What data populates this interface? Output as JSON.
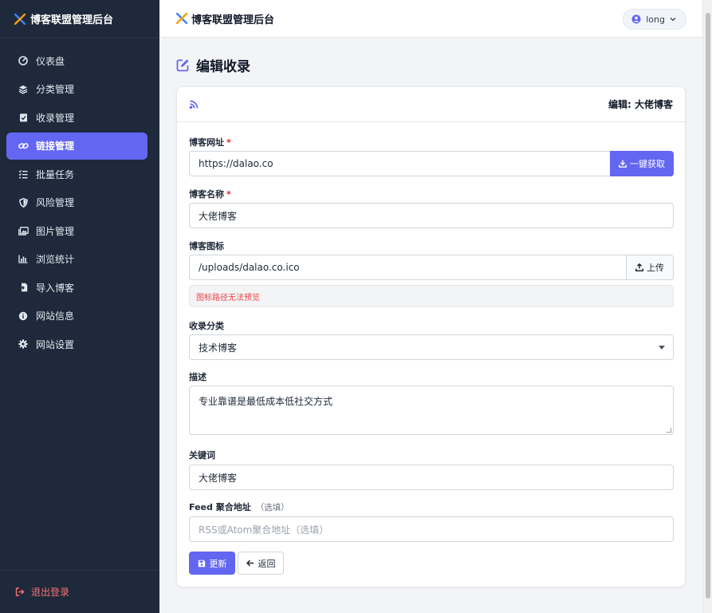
{
  "app": {
    "title": "博客联盟管理后台"
  },
  "sidebar": {
    "items": [
      {
        "label": "仪表盘",
        "icon": "dashboard-icon",
        "active": false
      },
      {
        "label": "分类管理",
        "icon": "layers-icon",
        "active": false
      },
      {
        "label": "收录管理",
        "icon": "clipboard-check-icon",
        "active": false
      },
      {
        "label": "链接管理",
        "icon": "link-icon",
        "active": true
      },
      {
        "label": "批量任务",
        "icon": "task-list-icon",
        "active": false
      },
      {
        "label": "风险管理",
        "icon": "shield-icon",
        "active": false
      },
      {
        "label": "图片管理",
        "icon": "image-icon",
        "active": false
      },
      {
        "label": "浏览统计",
        "icon": "bar-chart-icon",
        "active": false
      },
      {
        "label": "导入博客",
        "icon": "file-import-icon",
        "active": false
      },
      {
        "label": "网站信息",
        "icon": "info-icon",
        "active": false
      },
      {
        "label": "网站设置",
        "icon": "gear-icon",
        "active": false
      }
    ],
    "logout_label": "退出登录"
  },
  "header": {
    "title": "博客联盟管理后台",
    "user": "long"
  },
  "page": {
    "heading": "编辑收录"
  },
  "card": {
    "edit_title": "编辑: 大佬博客"
  },
  "form": {
    "url": {
      "label": "博客网址",
      "required": "*",
      "value": "https://dalao.co",
      "fetch_label": "一键获取"
    },
    "name": {
      "label": "博客名称",
      "required": "*",
      "value": "大佬博客"
    },
    "icon": {
      "label": "博客图标",
      "value": "/uploads/dalao.co.ico",
      "upload_label": "上传",
      "preview_error": "图标路径无法预览"
    },
    "category": {
      "label": "收录分类",
      "value": "技术博客"
    },
    "description": {
      "label": "描述",
      "value": "专业靠谱是最低成本低社交方式"
    },
    "keywords": {
      "label": "关键词",
      "value": "大佬博客"
    },
    "feed": {
      "label": "Feed 聚合地址",
      "optional": "（选填）",
      "placeholder": "RSS或Atom聚合地址（选填）"
    }
  },
  "actions": {
    "update_label": "更新",
    "back_label": "返回"
  },
  "colors": {
    "accent": "#6366f1",
    "sidebar_bg": "#1e293b",
    "danger": "#ef4444"
  }
}
